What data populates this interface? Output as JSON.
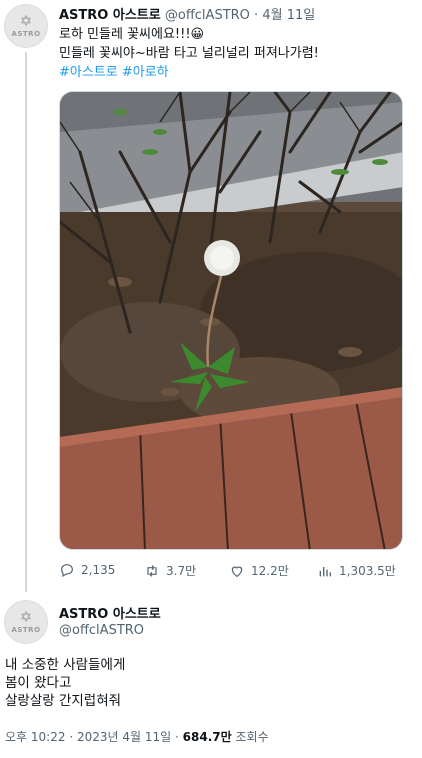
{
  "tweet1": {
    "author_name": "ASTRO 아스트로",
    "handle": "@offclASTRO",
    "separator": "·",
    "date": "4월 11일",
    "text_line1": "로하 민들레 꽃씨에요!!!😀",
    "text_line2": "민들레 꽃씨야~바람 타고 널리널리 퍼져나가렴!",
    "hashtags": [
      "#아스트로",
      "#아로하"
    ],
    "stats": {
      "replies": "2,135",
      "retweets": "3.7만",
      "likes": "12.2만",
      "views": "1,303.5만"
    }
  },
  "tweet2": {
    "author_name": "ASTRO 아스트로",
    "handle": "@offclASTRO",
    "text_lines": [
      "내 소중한 사람들에게",
      "봄이 왔다고",
      "살랑살랑 간지럽혀줘"
    ],
    "time": "오후 10:22",
    "sep1": "·",
    "date": "2023년 4월 11일",
    "sep2": "·",
    "views_count": "684.7만",
    "views_label": "조회수"
  },
  "avatar": {
    "logo_text": "ASTRO"
  },
  "colors": {
    "link": "#1d9bf0",
    "muted": "#536471",
    "text": "#0f1419"
  },
  "icons": [
    "reply-icon",
    "retweet-icon",
    "like-icon",
    "views-icon"
  ]
}
